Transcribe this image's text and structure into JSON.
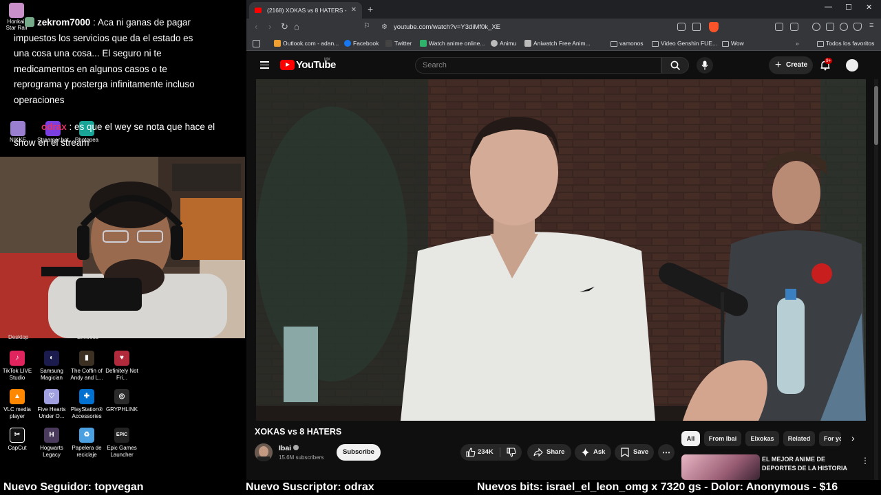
{
  "stream_overlay": {
    "chat": [
      {
        "user": "zekrom7000",
        "message": ": Aca ni ganas de pagar impuestos los servicios que da el estado es una cosa una cosa... El seguro ni te medicamentos en algunos casos o te reprograma y posterga infinitamente incluso operaciones"
      },
      {
        "user": "odrax",
        "message": ": es que el wey se nota que hace el show en el stream"
      }
    ],
    "top_desktop_icons": [
      {
        "label": "Honkai: Star Rail",
        "color": "#c98fc9"
      },
      {
        "label": "NIKKE",
        "color": "#9a7fd0"
      },
      {
        "label": "Streamer.bot",
        "color": "#7b3fe0"
      },
      {
        "label": "Photopea",
        "color": "#18a497"
      }
    ],
    "cut_labels": [
      "Desktop",
      "Exhoelia"
    ],
    "desktop_icons": [
      {
        "label": "TikTok LIVE Studio",
        "color": "#e0245e",
        "glyph": "♪"
      },
      {
        "label": "Samsung Magician",
        "color": "#1b1b4d",
        "glyph": "◐"
      },
      {
        "label": "The Coffin of Andy and L...",
        "color": "#3b3022",
        "glyph": "▮"
      },
      {
        "label": "Definitely Not Fri...",
        "color": "#b02a3c",
        "glyph": "♥"
      },
      {
        "label": "VLC media player",
        "color": "#ff8800",
        "glyph": "▲"
      },
      {
        "label": "Five Hearts Under O...",
        "color": "#a0a0e0",
        "glyph": "♡"
      },
      {
        "label": "PlayStation® Accessories",
        "color": "#0070d1",
        "glyph": "✚"
      },
      {
        "label": "GRYPHLINK",
        "color": "#2a2a2a",
        "glyph": "◎"
      },
      {
        "label": "CapCut",
        "color": "#111111",
        "glyph": "✂"
      },
      {
        "label": "Hogwarts Legacy",
        "color": "#4a3b5c",
        "glyph": "H"
      },
      {
        "label": "Papelera de reciclaje",
        "color": "#4aa0e0",
        "glyph": "♻"
      },
      {
        "label": "Epic Games Launcher",
        "color": "#222222",
        "glyph": "EPIC"
      }
    ]
  },
  "browser": {
    "tab_title": "(2168) XOKAS vs 8 HATERS - ",
    "new_tab": "+",
    "url": "youtube.com/watch?v=Y3diMf0k_XE",
    "window_controls": [
      "—",
      "☐",
      "✕"
    ],
    "bookmarks": [
      {
        "label": "Outlook.com - adan...",
        "color": "#f0a030",
        "folder": false
      },
      {
        "label": "Facebook",
        "color": "#1877f2",
        "folder": false
      },
      {
        "label": "Twitter",
        "color": "#222222",
        "folder": false
      },
      {
        "label": "Watch anime online...",
        "color": "#2fb36b",
        "folder": false
      },
      {
        "label": "Animu",
        "color": "#bbbbbb",
        "folder": false
      },
      {
        "label": "Aniwatch Free Anim...",
        "color": "#bbbbbb",
        "folder": false
      },
      {
        "label": "vamonos",
        "color": "#bdc1c6",
        "folder": true
      },
      {
        "label": "Video Genshin FUE...",
        "color": "#bdc1c6",
        "folder": true
      },
      {
        "label": "Wow",
        "color": "#bdc1c6",
        "folder": true
      },
      {
        "label": "Todos los favoritos",
        "color": "#bdc1c6",
        "folder": true
      }
    ]
  },
  "youtube": {
    "logo_text": "YouTube",
    "country": "MX",
    "search_placeholder": "Search",
    "create_label": "Create",
    "notifications": "9+",
    "video": {
      "title": "XOKAS vs 8 HATERS",
      "channel": "Ibai",
      "subscribers": "15.6M subscribers",
      "subscribe_label": "Subscribe",
      "likes": "234K",
      "share_label": "Share",
      "ask_label": "Ask",
      "save_label": "Save"
    },
    "chips": [
      "All",
      "From Ibai",
      "Elxokas",
      "Related",
      "For yo"
    ],
    "recommended": {
      "title": "EL MEJOR ANIME DE DEPORTES DE LA HISTORIA"
    }
  },
  "ticker": {
    "follower": "Nuevo Seguidor: topvegan",
    "subscriber": "Nuevo Suscriptor: odrax",
    "bits": "Nuevos bits: israel_el_leon_omg x 7320",
    "donation": "gs - Dolor: Anonymous - $16"
  },
  "colors": {
    "yt_red": "#ff0000",
    "bg": "#0f0f0f",
    "chrome_bar": "#35363a"
  }
}
